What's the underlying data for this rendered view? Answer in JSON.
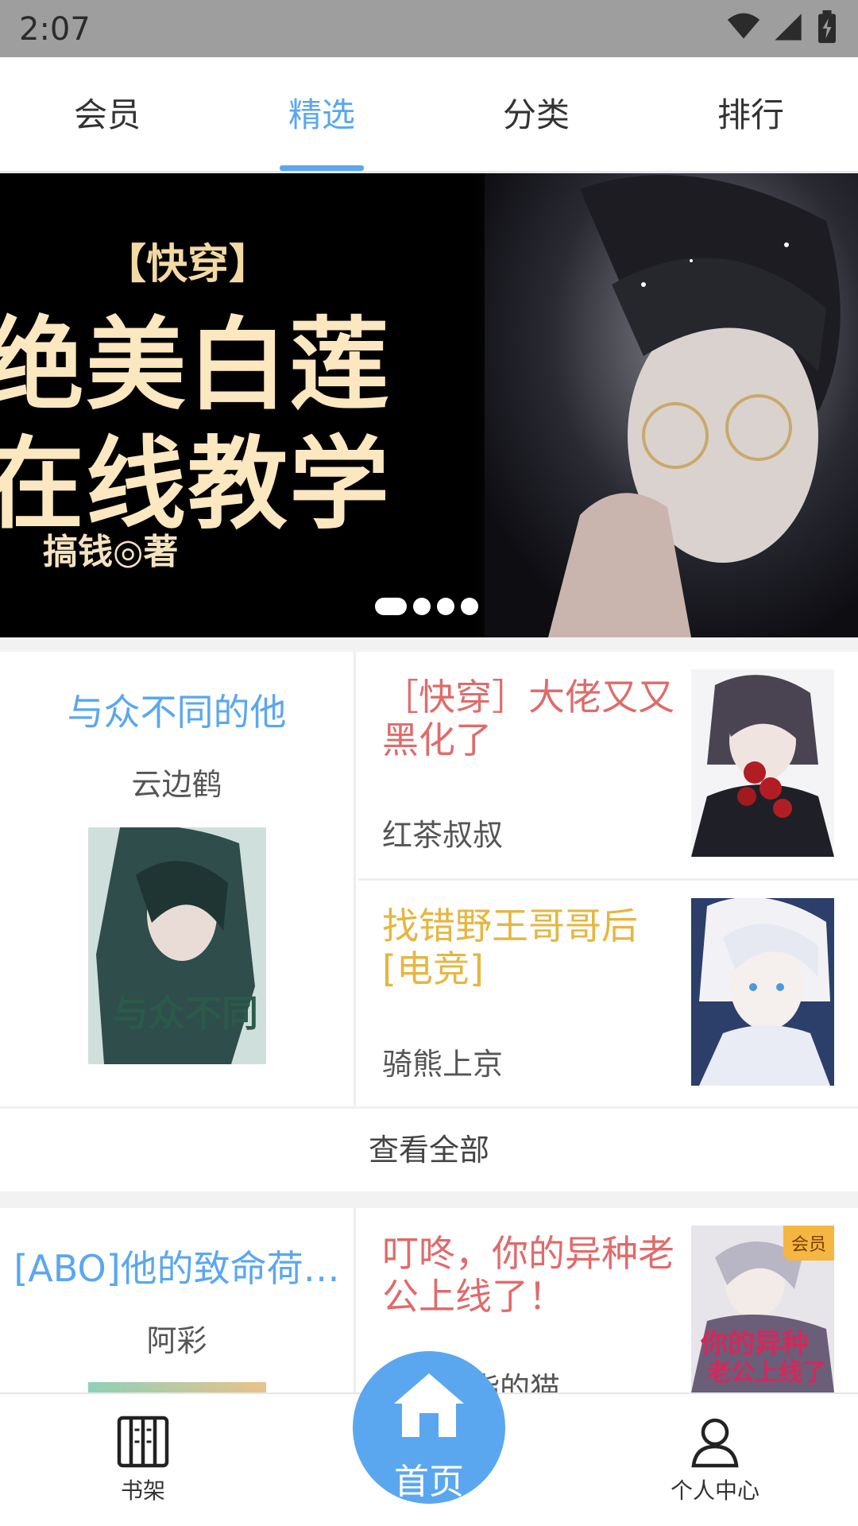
{
  "status": {
    "time": "2:07"
  },
  "tabs": [
    {
      "label": "会员",
      "active": false
    },
    {
      "label": "精选",
      "active": true
    },
    {
      "label": "分类",
      "active": false
    },
    {
      "label": "排行",
      "active": false
    }
  ],
  "banner": {
    "tag": "【快穿】",
    "line1": "绝美白莲",
    "line2": "在线教学",
    "author": "搞钱◎著",
    "dots": 4,
    "active_dot": 0
  },
  "section1": {
    "feature": {
      "title": "与众不同的他",
      "author": "云边鹤",
      "title_color": "#5aa7f0"
    },
    "items": [
      {
        "title": "［快穿］大佬又又黑化了",
        "author": "红茶叔叔",
        "title_color": "#e06b6b"
      },
      {
        "title": "找错野王哥哥后[电竞]",
        "author": "骑熊上京",
        "title_color": "#e6b640"
      }
    ],
    "view_all": "查看全部"
  },
  "section2": {
    "feature": {
      "title": "[ABO]他的致命荷…",
      "author": "阿彩",
      "title_color": "#5aa7f0"
    },
    "items": [
      {
        "title": "叮咚，你的异种老公上线了！",
        "author": "指的猫",
        "title_color": "#e06b6b",
        "badge": "会员"
      }
    ]
  },
  "bottom_nav": {
    "bookshelf": "书架",
    "home": "首页",
    "profile": "个人中心"
  }
}
